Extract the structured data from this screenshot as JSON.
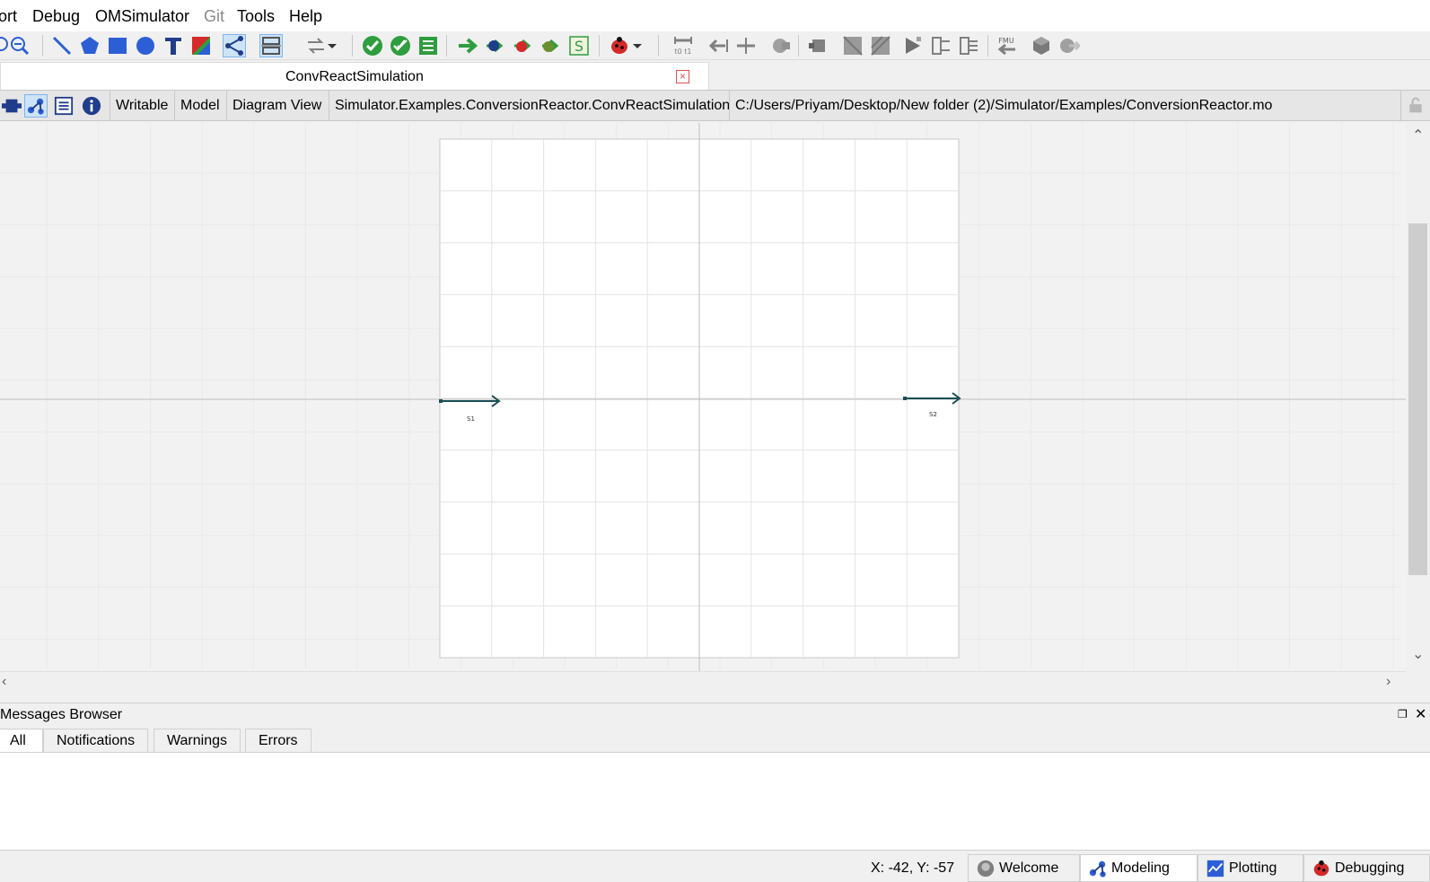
{
  "menu": {
    "items": [
      {
        "label": "ort",
        "enabled": true
      },
      {
        "label": "Debug",
        "enabled": true
      },
      {
        "label": "OMSimulator",
        "enabled": true
      },
      {
        "label": "Git",
        "enabled": false
      },
      {
        "label": "Tools",
        "enabled": true
      },
      {
        "label": "Help",
        "enabled": true
      }
    ]
  },
  "toolbar": {
    "timing_label": "t0 t1",
    "fmu_label": "FMU",
    "simulate_s_label": "S",
    "colors": {
      "green": "#2e9e3e",
      "blue": "#2c5fd6",
      "red": "#d42a2a",
      "gray": "#808080"
    }
  },
  "document": {
    "tab_title": "ConvReactSimulation",
    "close_glyph": "×"
  },
  "info_bar": {
    "access": "Writable",
    "class_type": "Model",
    "view": "Diagram View",
    "class_name": "Simulator.Examples.ConversionReactor.ConvReactSimulation",
    "file_path": "C:/Users/Priyam/Desktop/New folder (2)/Simulator/Examples/ConversionReactor.mo"
  },
  "diagram": {
    "connectors": [
      {
        "label": "S1"
      },
      {
        "label": "S2"
      }
    ],
    "connector_color": "#1a4f55"
  },
  "messages": {
    "title": "Messages Browser",
    "tabs": [
      "All",
      "Notifications",
      "Warnings",
      "Errors"
    ],
    "selected_tab": "All"
  },
  "status": {
    "coordinates": "X: -42, Y: -57",
    "perspectives": [
      {
        "label": "Welcome",
        "selected": false
      },
      {
        "label": "Modeling",
        "selected": true
      },
      {
        "label": "Plotting",
        "selected": false
      },
      {
        "label": "Debugging",
        "selected": false
      }
    ]
  }
}
